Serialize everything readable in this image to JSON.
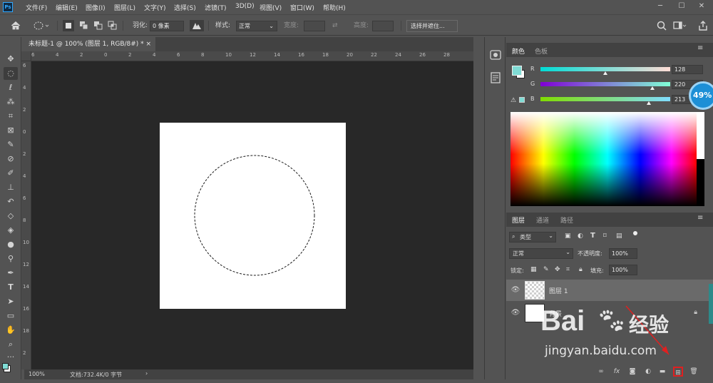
{
  "app": {
    "logo": "Ps"
  },
  "menu": [
    "文件(F)",
    "编辑(E)",
    "图像(I)",
    "图层(L)",
    "文字(Y)",
    "选择(S)",
    "滤镜(T)",
    "3D(D)",
    "视图(V)",
    "窗口(W)",
    "帮助(H)"
  ],
  "window_controls": {
    "minimize": "─",
    "maximize": "☐",
    "close": "✕"
  },
  "options": {
    "feather_label": "羽化:",
    "feather_value": "0 像素",
    "style_label": "样式:",
    "style_value": "正常",
    "width_label": "宽度:",
    "height_label": "高度:",
    "select_mask_button": "选择并遮住..."
  },
  "document": {
    "tab_title": "未标题-1 @ 100% (图层 1, RGB/8#) *",
    "tab_close": "×",
    "zoom": "100%",
    "doc_info": "文档:732.4K/0 字节",
    "ruler_top": [
      "6",
      "4",
      "2",
      "0",
      "2",
      "4",
      "6",
      "8",
      "10",
      "12",
      "14",
      "16",
      "18",
      "20",
      "22",
      "24",
      "26",
      "28"
    ],
    "ruler_left": [
      "6",
      "4",
      "2",
      "0",
      "2",
      "4",
      "6",
      "8",
      "10",
      "12",
      "14",
      "16",
      "18",
      "2"
    ]
  },
  "color_panel": {
    "tabs": [
      "颜色",
      "色板"
    ],
    "r_label": "R",
    "r_value": "128",
    "g_label": "G",
    "g_value": "220",
    "b_label": "B",
    "b_value": "213",
    "r": 128,
    "g": 220,
    "b": 213,
    "foreground_color": "#80dcd5"
  },
  "badge": {
    "percent": "49%"
  },
  "layers_panel": {
    "tabs": [
      "图层",
      "通道",
      "路径"
    ],
    "filter_kind": "类型",
    "blend_mode": "正常",
    "opacity_label": "不透明度:",
    "opacity_value": "100%",
    "lock_label": "锁定:",
    "fill_label": "填充:",
    "fill_value": "100%",
    "layers": [
      {
        "name": "图层 1",
        "selected": true
      },
      {
        "name": "背景",
        "selected": false
      }
    ]
  },
  "watermark": {
    "brand": "Bai",
    "brand_cn": "经验",
    "url": "jingyan.baidu.com"
  },
  "colors": {
    "accent": "#31a8ff",
    "highlight_box": "#e02020",
    "arrow": "#e02020"
  }
}
